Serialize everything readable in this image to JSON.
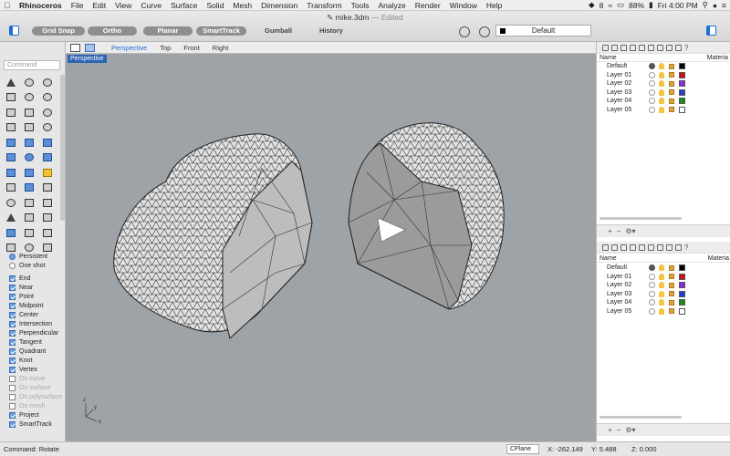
{
  "menubar": {
    "app": "Rhinoceros",
    "items": [
      "File",
      "Edit",
      "View",
      "Curve",
      "Surface",
      "Solid",
      "Mesh",
      "Dimension",
      "Transform",
      "Tools",
      "Analyze",
      "Render",
      "Window",
      "Help"
    ],
    "status": {
      "num": "8",
      "battery": "88%",
      "clock": "Fri 4:00 PM"
    }
  },
  "window": {
    "title": "mike.3dm",
    "edited": "— Edited"
  },
  "toolbar": {
    "grid_snap": "Grid Snap",
    "ortho": "Ortho",
    "planar": "Planar",
    "smarttrack": "SmartTrack",
    "gumball": "Gumball",
    "history": "History",
    "layer_select": "Default"
  },
  "command": {
    "placeholder": "Command",
    "status": "Command: Rotate"
  },
  "viewport_tabs": [
    "Perspective",
    "Top",
    "Front",
    "Right"
  ],
  "viewport": {
    "label": "Perspective",
    "axis_x": "x",
    "axis_y": "y",
    "axis_z": "z"
  },
  "osnap": {
    "persistent": "Persistent",
    "one_shot": "One shot",
    "items": [
      {
        "label": "End",
        "checked": true
      },
      {
        "label": "Near",
        "checked": true
      },
      {
        "label": "Point",
        "checked": true
      },
      {
        "label": "Midpoint",
        "checked": true
      },
      {
        "label": "Center",
        "checked": true
      },
      {
        "label": "Intersection",
        "checked": true
      },
      {
        "label": "Perpendicular",
        "checked": true
      },
      {
        "label": "Tangent",
        "checked": true
      },
      {
        "label": "Quadrant",
        "checked": true
      },
      {
        "label": "Knot",
        "checked": true
      },
      {
        "label": "Vertex",
        "checked": true
      },
      {
        "label": "On curve",
        "checked": false,
        "disabled": true
      },
      {
        "label": "On surface",
        "checked": false,
        "disabled": true
      },
      {
        "label": "On polysurface",
        "checked": false,
        "disabled": true
      },
      {
        "label": "On mesh",
        "checked": false,
        "disabled": true
      },
      {
        "label": "Project",
        "checked": true
      },
      {
        "label": "SmartTrack",
        "checked": true
      }
    ]
  },
  "layers_panel": {
    "name_header": "Name",
    "material_header": "Materia",
    "layers": [
      {
        "name": "Default",
        "color": "#000000",
        "current": true
      },
      {
        "name": "Layer 01",
        "color": "#cc1111"
      },
      {
        "name": "Layer 02",
        "color": "#8a2be2"
      },
      {
        "name": "Layer 03",
        "color": "#1f3fd6"
      },
      {
        "name": "Layer 04",
        "color": "#1a8a1a"
      },
      {
        "name": "Layer 05",
        "color": "#ffffff"
      }
    ]
  },
  "statusbar": {
    "cplane": "CPlane",
    "x": "X: -262.149",
    "y": "Y: 5.488",
    "z": "Z: 0.000"
  },
  "colors": {
    "accent": "#1a6fd6",
    "viewport_bg": "#9ea3a8",
    "viewport_label_bg": "#2d63b0"
  }
}
